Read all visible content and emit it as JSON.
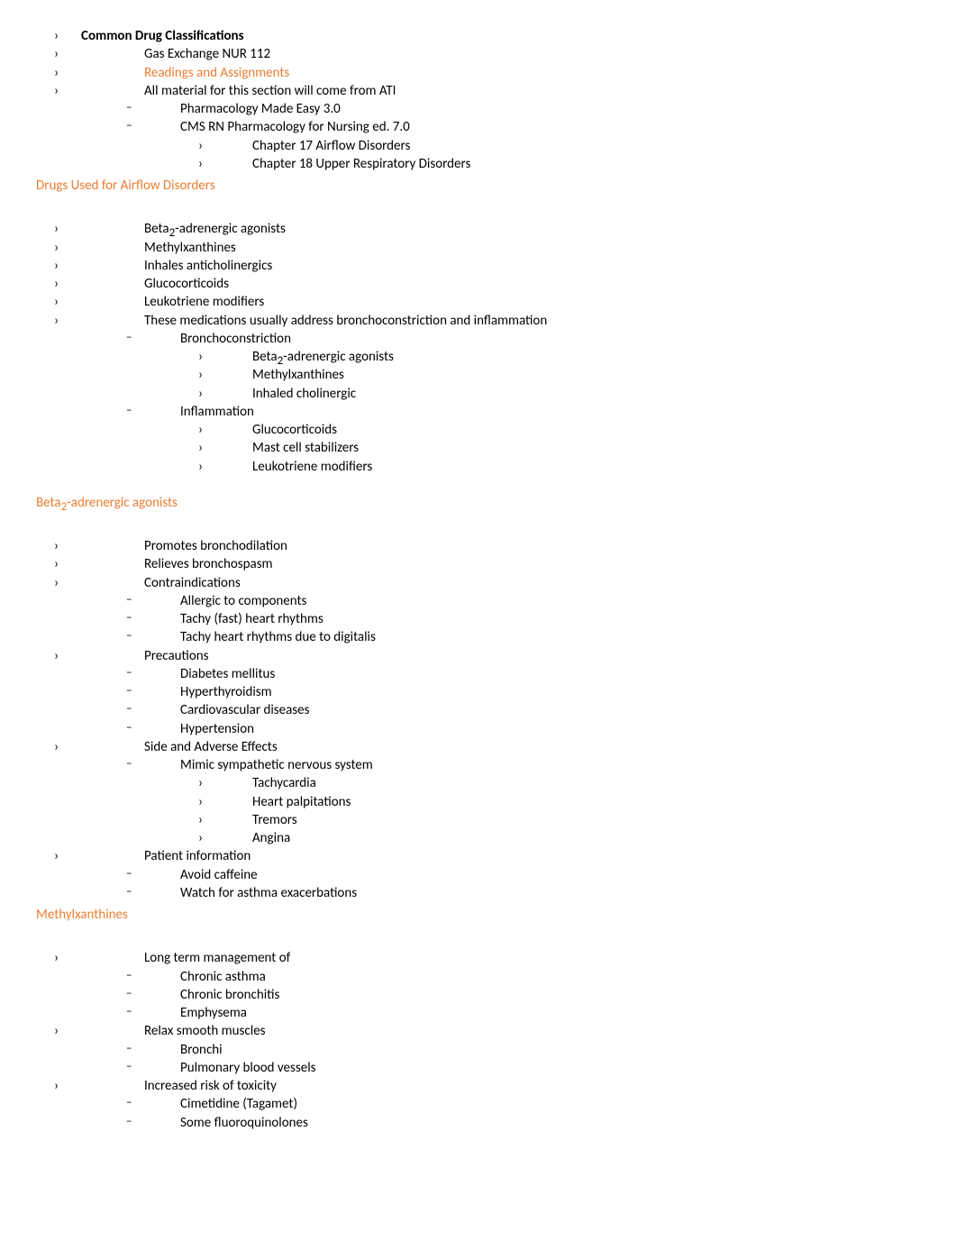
{
  "header": {
    "title": "Common Drug Classifications",
    "course": "Gas Exchange NUR 112",
    "readings_label": "Readings and Assignments",
    "material_intro": "All material for this section will come from ATI",
    "materials": {
      "pharm_easy": "Pharmacology Made Easy 3.0",
      "cms_rn": "CMS RN Pharmacology for Nursing ed. 7.0",
      "chapter17": "Chapter 17 Airflow Disorders",
      "chapter18": "Chapter 18 Upper Respiratory Disorders"
    }
  },
  "section_airflow": {
    "title": "Drugs Used for Airflow Disorders",
    "items": {
      "beta2_agonists": "Beta",
      "beta2_suffix": "-adrenergic agonists",
      "sub2": "2",
      "methylxanthines": "Methylxanthines",
      "inhales_anti": "Inhales anticholinergics",
      "glucocorticoids": "Glucocorticoids",
      "leukotriene": "Leukotriene modifiers",
      "address": "These medications usually address bronchoconstriction and inflammation",
      "broncho": "Bronchoconstriction",
      "broncho_beta2": "Beta",
      "broncho_beta2_suffix": "-adrenergic agonists",
      "broncho_methyl": "Methylxanthines",
      "broncho_inhaled": "Inhaled cholinergic",
      "inflammation": "Inflammation",
      "infl_gluco": "Glucocorticoids",
      "infl_mast": "Mast cell stabilizers",
      "infl_leuko": "Leukotriene modifiers"
    }
  },
  "section_beta2": {
    "title_prefix": "Beta",
    "title_sub": "2",
    "title_suffix": "-adrenergic agonists",
    "promotes": "Promotes bronchodilation",
    "relieves": "Relieves bronchospasm",
    "contraindications": "Contraindications",
    "ci_allergic": "Allergic to components",
    "ci_tachy": "Tachy (fast) heart rhythms",
    "ci_tachy_dig": "Tachy heart rhythms due to digitalis",
    "precautions": "Precautions",
    "pre_dm": "Diabetes mellitus",
    "pre_hyper": "Hyperthyroidism",
    "pre_cardio": "Cardiovascular diseases",
    "pre_htn": "Hypertension",
    "side_effects": "Side and Adverse Effects",
    "se_mimic": "Mimic sympathetic nervous system",
    "se_tachy": "Tachycardia",
    "se_palp": "Heart palpitations",
    "se_tremors": "Tremors",
    "se_angina": "Angina",
    "patient_info": "Patient information",
    "pi_caffeine": "Avoid caffeine",
    "pi_asthma": "Watch for asthma exacerbations"
  },
  "section_methyl": {
    "title": "Methylxanthines",
    "long_term": "Long term management of",
    "lt_asthma": "Chronic asthma",
    "lt_bronchitis": "Chronic bronchitis",
    "lt_emphysema": "Emphysema",
    "relax": "Relax smooth muscles",
    "relax_bronchi": "Bronchi",
    "relax_pulm": "Pulmonary blood vessels",
    "toxicity": "Increased risk of toxicity",
    "tox_cimetidine": "Cimetidine (Tagamet)",
    "tox_fluoro": "Some fluoroquinolones"
  }
}
